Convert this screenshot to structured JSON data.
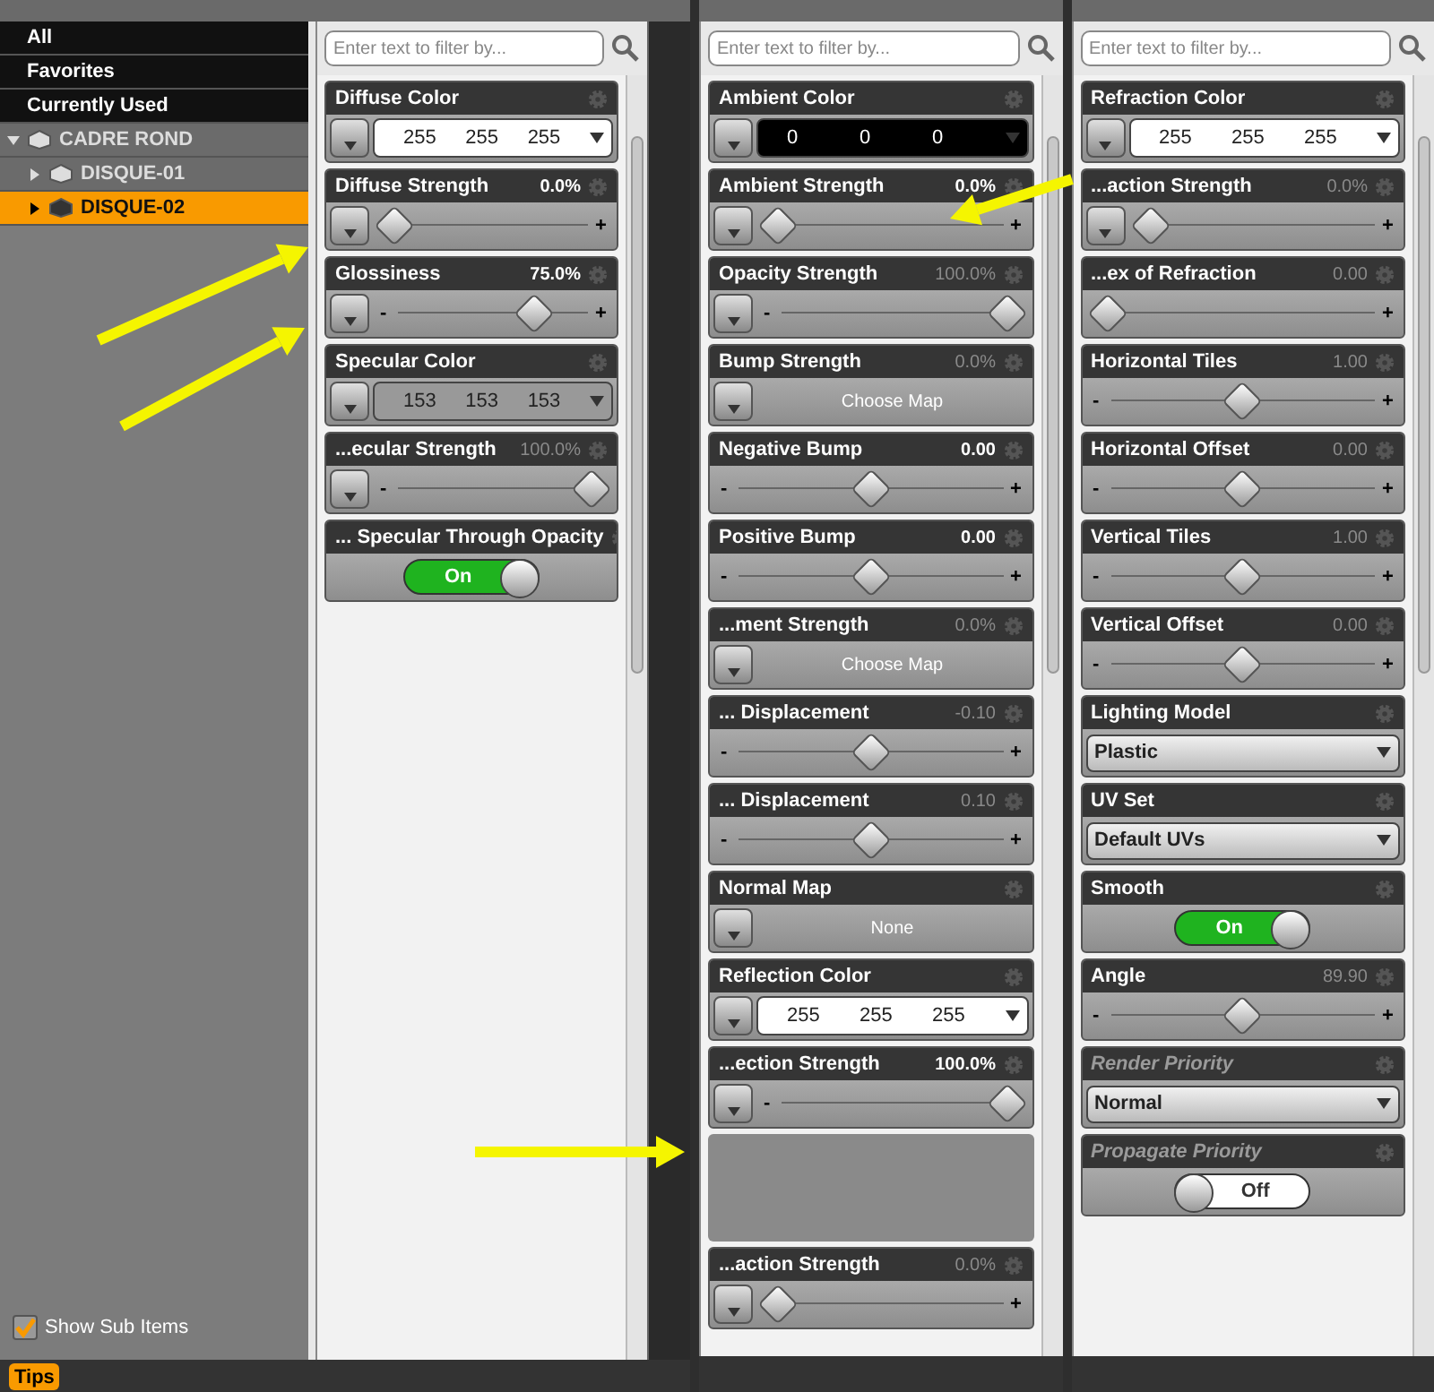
{
  "tree_panel": {
    "filters": [
      {
        "label": "All",
        "selected": false
      },
      {
        "label": "Favorites",
        "selected": false
      },
      {
        "label": "Currently Used",
        "selected": false
      }
    ],
    "tree": [
      {
        "label": "CADRE ROND",
        "expanded": true,
        "selected": false,
        "children": [
          {
            "label": "DISQUE-01",
            "expanded": false,
            "selected": false
          },
          {
            "label": "DISQUE-02",
            "expanded": false,
            "selected": true
          }
        ]
      }
    ],
    "show_sub_items": {
      "label": "Show Sub Items",
      "checked": true
    },
    "tips": "Tips"
  },
  "columns": [
    {
      "filter_placeholder": "Enter text to filter by...",
      "properties": [
        {
          "kind": "color",
          "label": "Diffuse Color",
          "values": [
            "255",
            "255",
            "255"
          ],
          "color": "#ffffff",
          "menu": true
        },
        {
          "kind": "slider",
          "label": "Diffuse Strength",
          "value": "0.0%",
          "dim": false,
          "level": 0,
          "plus": "+",
          "menu": true
        },
        {
          "kind": "slider",
          "label": "Glossiness",
          "value": "75.0%",
          "dim": false,
          "level": 0.75,
          "minus": "-",
          "plus": "+",
          "menu": true
        },
        {
          "kind": "color",
          "label": "Specular Color",
          "values": [
            "153",
            "153",
            "153"
          ],
          "color": "#999999",
          "menu": true
        },
        {
          "kind": "slider",
          "label": "...ecular Strength",
          "value": "100.0%",
          "dim": true,
          "level": 1,
          "minus": "-",
          "menu": true
        },
        {
          "kind": "toggle",
          "label": "... Specular Through Opacity",
          "state": "On",
          "on": true
        }
      ]
    },
    {
      "filter_placeholder": "Enter text to filter by...",
      "properties": [
        {
          "kind": "color",
          "label": "Ambient Color",
          "values": [
            "0",
            "0",
            "0"
          ],
          "color": "#000000",
          "menu": true
        },
        {
          "kind": "slider",
          "label": "Ambient Strength",
          "value": "0.0%",
          "dim": false,
          "level": 0,
          "plus": "+",
          "menu": true
        },
        {
          "kind": "slider",
          "label": "Opacity Strength",
          "value": "100.0%",
          "dim": true,
          "level": 1,
          "minus": "-",
          "menu": true
        },
        {
          "kind": "map",
          "label": "Bump Strength",
          "value": "0.0%",
          "dim": true,
          "map": "Choose Map",
          "menu": true
        },
        {
          "kind": "slider",
          "label": "Negative Bump",
          "value": "0.00",
          "dim": false,
          "level": 0.5,
          "minus": "-",
          "plus": "+",
          "menu": false
        },
        {
          "kind": "slider",
          "label": "Positive Bump",
          "value": "0.00",
          "dim": false,
          "level": 0.5,
          "minus": "-",
          "plus": "+",
          "menu": false
        },
        {
          "kind": "map",
          "label": "...ment Strength",
          "value": "0.0%",
          "dim": true,
          "map": "Choose Map",
          "menu": true
        },
        {
          "kind": "slider",
          "label": "... Displacement",
          "value": "-0.10",
          "dim": true,
          "level": 0.5,
          "minus": "-",
          "plus": "+",
          "menu": false
        },
        {
          "kind": "slider",
          "label": "... Displacement",
          "value": "0.10",
          "dim": true,
          "level": 0.5,
          "minus": "-",
          "plus": "+",
          "menu": false
        },
        {
          "kind": "map",
          "label": "Normal Map",
          "map": "None",
          "menu": true
        },
        {
          "kind": "color",
          "label": "Reflection Color",
          "values": [
            "255",
            "255",
            "255"
          ],
          "color": "#ffffff",
          "menu": true
        },
        {
          "kind": "slider",
          "label": "...ection Strength",
          "value": "100.0%",
          "dim": false,
          "level": 1,
          "minus": "-",
          "menu": true
        },
        {
          "kind": "blank"
        },
        {
          "kind": "slider",
          "label": "...action Strength",
          "value": "0.0%",
          "dim": true,
          "level": 0,
          "plus": "+",
          "menu": true
        }
      ]
    },
    {
      "filter_placeholder": "Enter text to filter by...",
      "properties": [
        {
          "kind": "color",
          "label": "Refraction Color",
          "values": [
            "255",
            "255",
            "255"
          ],
          "color": "#ffffff",
          "menu": true
        },
        {
          "kind": "slider",
          "label": "...action Strength",
          "value": "0.0%",
          "dim": true,
          "level": 0,
          "plus": "+",
          "menu": true
        },
        {
          "kind": "slider",
          "label": "...ex of Refraction",
          "value": "0.00",
          "dim": true,
          "level": 0,
          "plus": "+",
          "menu": false
        },
        {
          "kind": "slider",
          "label": "Horizontal Tiles",
          "value": "1.00",
          "dim": true,
          "level": 0.5,
          "minus": "-",
          "plus": "+",
          "menu": false
        },
        {
          "kind": "slider",
          "label": "Horizontal Offset",
          "value": "0.00",
          "dim": true,
          "level": 0.5,
          "minus": "-",
          "plus": "+",
          "menu": false
        },
        {
          "kind": "slider",
          "label": "Vertical Tiles",
          "value": "1.00",
          "dim": true,
          "level": 0.5,
          "minus": "-",
          "plus": "+",
          "menu": false
        },
        {
          "kind": "slider",
          "label": "Vertical Offset",
          "value": "0.00",
          "dim": true,
          "level": 0.5,
          "minus": "-",
          "plus": "+",
          "menu": false
        },
        {
          "kind": "select",
          "label": "Lighting Model",
          "value": "Plastic",
          "disabled": false
        },
        {
          "kind": "select",
          "label": "UV Set",
          "value": "Default UVs",
          "disabled": false
        },
        {
          "kind": "toggle",
          "label": "Smooth",
          "state": "On",
          "on": true,
          "disabled": false
        },
        {
          "kind": "slider",
          "label": "Angle",
          "value": "89.90",
          "dim": true,
          "level": 0.5,
          "minus": "-",
          "plus": "+",
          "menu": false
        },
        {
          "kind": "select",
          "label": "Render Priority",
          "value": "Normal",
          "disabled": true
        },
        {
          "kind": "toggle",
          "label": "Propagate Priority",
          "state": "Off",
          "on": false,
          "disabled": true
        }
      ]
    }
  ]
}
